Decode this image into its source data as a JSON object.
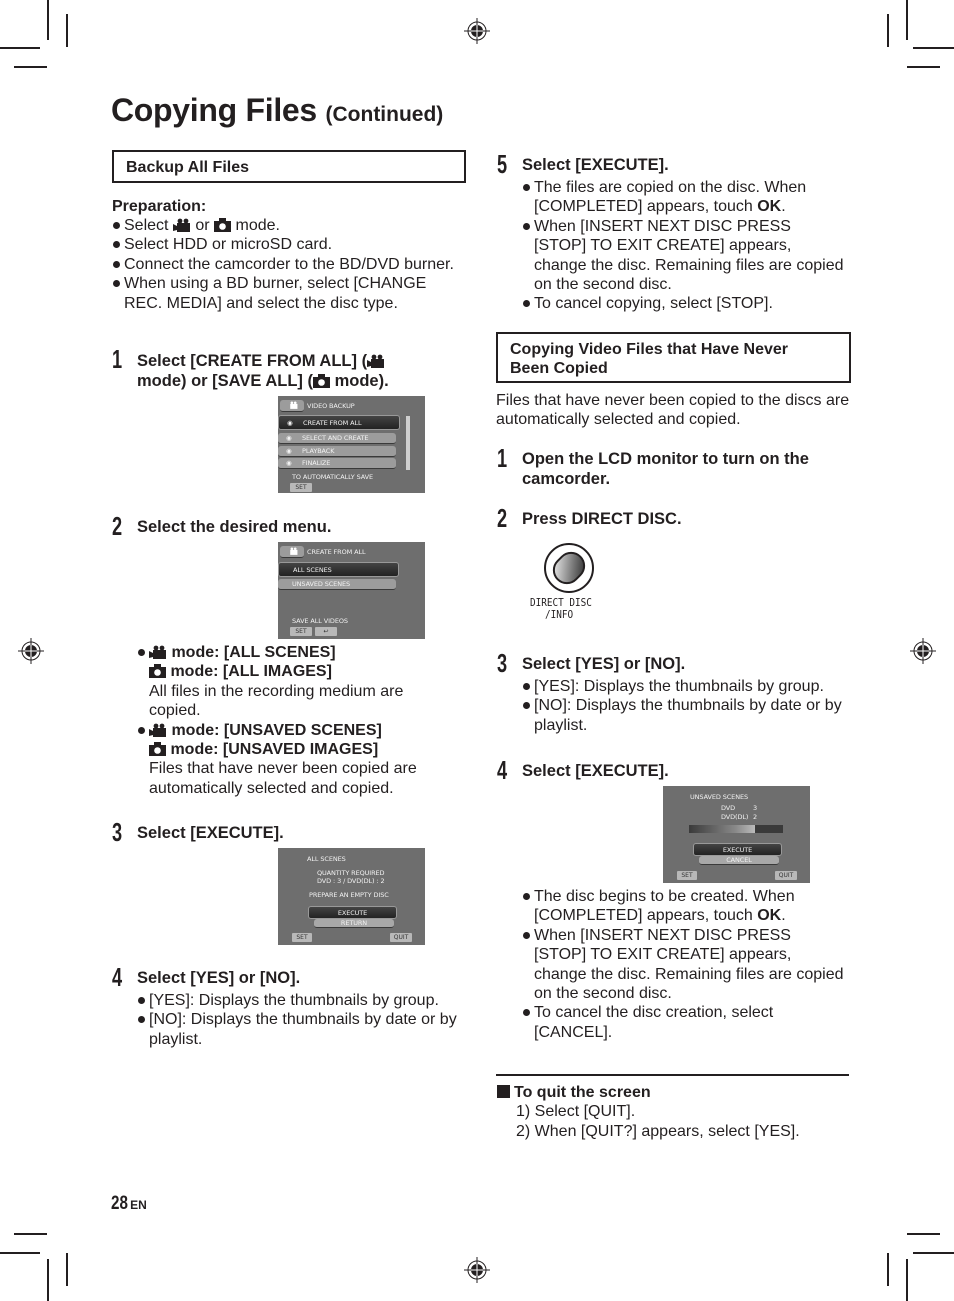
{
  "page": {
    "title": "Copying Files",
    "title_suffix": "(Continued)",
    "page_number": "28",
    "language": "EN"
  },
  "left": {
    "section_heading": "Backup All Files",
    "preparation_label": "Preparation:",
    "preparation": [
      {
        "before": "Select",
        "icon1": "video-mode-icon",
        "mid": "or",
        "icon2": "camera-mode-icon",
        "after": "mode."
      },
      {
        "text": "Select HDD or microSD card."
      },
      {
        "text": "Connect the camcorder to the BD/DVD burner."
      },
      {
        "text": "When using a BD burner, select [CHANGE REC. MEDIA] and select the disc type."
      }
    ],
    "steps": [
      {
        "number": "1",
        "heading_line1_a": "Select [CREATE FROM ALL] (",
        "heading_line2_a": "mode) or [SAVE ALL] (",
        "heading_line2_b": "mode).",
        "screen": {
          "header": "VIDEO BACKUP",
          "items": [
            "CREATE FROM ALL",
            "SELECT AND CREATE",
            "PLAYBACK",
            "FINALIZE"
          ],
          "footer": "TO AUTOMATICALLY SAVE",
          "set": "SET"
        }
      },
      {
        "number": "2",
        "heading": "Select the desired menu.",
        "screen": {
          "header": "CREATE FROM ALL",
          "items": [
            "ALL SCENES",
            "UNSAVED SCENES"
          ],
          "footer": "SAVE ALL VIDEOS",
          "set": "SET",
          "back": "↩"
        },
        "options": [
          {
            "video_label": "mode: [ALL SCENES]",
            "photo_label": "mode: [ALL IMAGES]",
            "desc": "All files in the recording medium are copied."
          },
          {
            "video_label": "mode: [UNSAVED SCENES]",
            "photo_label": "mode: [UNSAVED IMAGES]",
            "desc": "Files that have never been copied are automatically selected and copied."
          }
        ]
      },
      {
        "number": "3",
        "heading": "Select [EXECUTE].",
        "screen": {
          "header": "ALL SCENES",
          "line1": "QUANTITY REQUIRED",
          "line2": "DVD : 3 / DVD(DL) : 2",
          "line3": "PREPARE AN EMPTY DISC",
          "execute": "EXECUTE",
          "return": "RETURN",
          "set": "SET",
          "quit": "QUIT"
        }
      },
      {
        "number": "4",
        "heading": "Select [YES] or [NO].",
        "bullets": [
          "[YES]: Displays the thumbnails by group.",
          "[NO]: Displays the thumbnails by date or by playlist."
        ]
      }
    ]
  },
  "right": {
    "step5": {
      "number": "5",
      "heading": "Select [EXECUTE].",
      "bullet1_a": "The files are copied on the disc. When [COMPLETED] appears, touch ",
      "bullet1_b": "OK",
      "bullet1_c": ".",
      "bullet2": "When [INSERT NEXT DISC PRESS [STOP] TO EXIT CREATE] appears, change the disc. Remaining files are copied on the second disc.",
      "bullet3": "To cancel copying, select [STOP]."
    },
    "section_heading": "Copying Video Files that Have Never Been Copied",
    "intro": "Files that have never been copied to the discs are automatically selected and copied.",
    "steps": [
      {
        "number": "1",
        "heading": "Open the LCD monitor to turn on the camcorder."
      },
      {
        "number": "2",
        "heading": "Press DIRECT DISC.",
        "button_label_line1": "DIRECT DISC",
        "button_label_line2": "/INFO"
      },
      {
        "number": "3",
        "heading": "Select [YES] or [NO].",
        "bullets": [
          "[YES]: Displays the thumbnails by group.",
          "[NO]: Displays the thumbnails by date or by playlist."
        ]
      },
      {
        "number": "4",
        "heading": "Select [EXECUTE].",
        "screen": {
          "header": "UNSAVED SCENES",
          "dvd_label": "DVD",
          "dvd_value": "3",
          "dvddl_label": "DVD(DL)",
          "dvddl_value": "2",
          "progress": 0.7,
          "execute": "EXECUTE",
          "cancel": "CANCEL",
          "set": "SET",
          "quit": "QUIT"
        },
        "bullet1_a": "The disc begins to be created. When [COMPLETED] appears, touch ",
        "bullet1_b": "OK",
        "bullet1_c": ".",
        "bullet2": "When [INSERT NEXT DISC PRESS [STOP] TO EXIT CREATE] appears, change the disc. Remaining files are copied on the second disc.",
        "bullet3": "To cancel the disc creation, select [CANCEL]."
      }
    ],
    "quit": {
      "heading": "To quit the screen",
      "items": [
        "1) Select [QUIT].",
        "2) When [QUIT?] appears, select [YES]."
      ]
    }
  }
}
